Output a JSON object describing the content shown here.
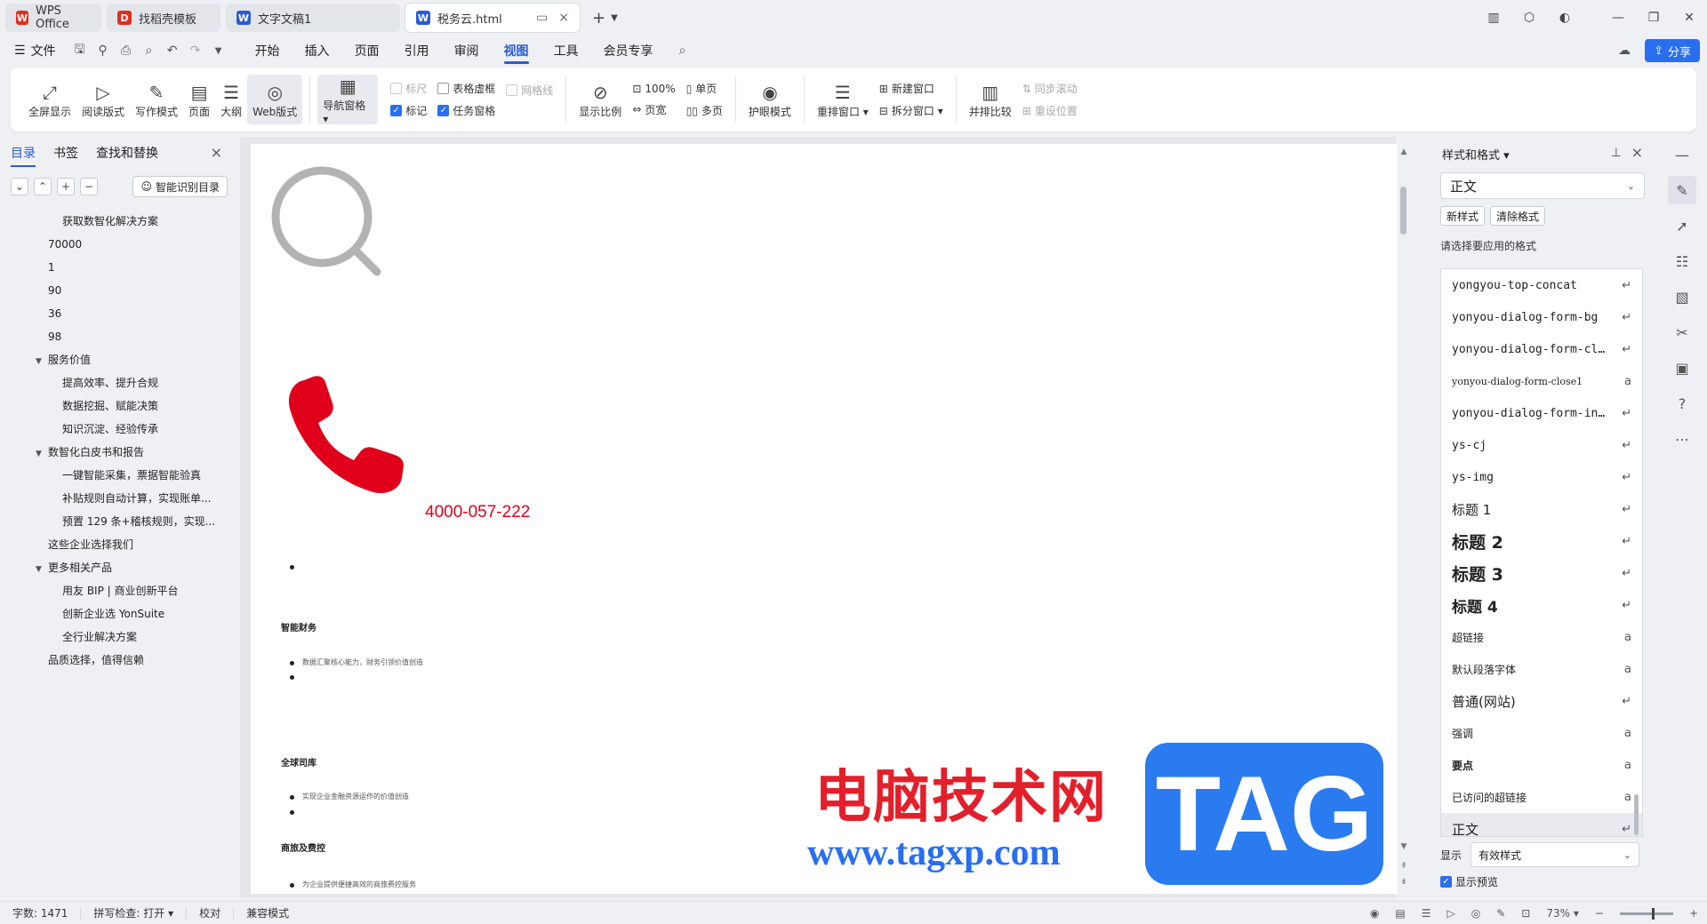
{
  "tabs": [
    {
      "label": "WPS Office",
      "icon": "wps-logo-icon",
      "color": "#e0301e",
      "glyph": "W"
    },
    {
      "label": "找稻壳模板",
      "icon": "docer-icon",
      "color": "#e0301e",
      "glyph": "D"
    },
    {
      "label": "文字文稿1",
      "icon": "writer-icon",
      "color": "#2a5bd7",
      "glyph": "W"
    },
    {
      "label": "税务云.html",
      "icon": "writer-icon",
      "color": "#2a5bd7",
      "glyph": "W"
    }
  ],
  "menu": {
    "file": "文件",
    "items": [
      "开始",
      "插入",
      "页面",
      "引用",
      "审阅",
      "视图",
      "工具",
      "会员专享"
    ],
    "active": "视图",
    "share": "分享"
  },
  "ribbon": {
    "fullscreen": "全屏显示",
    "reading": "阅读版式",
    "writing": "写作模式",
    "page": "页面",
    "outline": "大纲",
    "web": "Web版式",
    "navpane": "导航窗格",
    "ruler": "标尺",
    "table_grid": "表格虚框",
    "gridlines": "网格线",
    "marks": "标记",
    "taskpane": "任务窗格",
    "zoom": "显示比例",
    "hundred": "100%",
    "pagewidth": "页宽",
    "single": "单页",
    "multi": "多页",
    "eyecare": "护眼模式",
    "arrange": "重排窗口",
    "newwindow": "新建窗口",
    "split": "拆分窗口",
    "sidebyside": "并排比较",
    "syncscroll": "同步滚动",
    "resetpos": "重设位置"
  },
  "leftpane": {
    "tabs": [
      "目录",
      "书签",
      "查找和替换"
    ],
    "smart_toc": "智能识别目录",
    "toc": [
      {
        "text": "获取数智化解决方案",
        "level": 2,
        "caret": ""
      },
      {
        "text": "70000",
        "level": 1,
        "caret": ""
      },
      {
        "text": "1",
        "level": 1,
        "caret": ""
      },
      {
        "text": "90",
        "level": 1,
        "caret": ""
      },
      {
        "text": "36",
        "level": 1,
        "caret": ""
      },
      {
        "text": "98",
        "level": 1,
        "caret": ""
      },
      {
        "text": "服务价值",
        "level": 1,
        "caret": "▼"
      },
      {
        "text": "提高效率、提升合规",
        "level": 2,
        "caret": ""
      },
      {
        "text": "数据挖掘、赋能决策",
        "level": 2,
        "caret": ""
      },
      {
        "text": "知识沉淀、经验传承",
        "level": 2,
        "caret": ""
      },
      {
        "text": "数智化白皮书和报告",
        "level": 1,
        "caret": "▼"
      },
      {
        "text": "一键智能采集，票据智能验真",
        "level": 2,
        "caret": ""
      },
      {
        "text": "补贴规则自动计算，实现账单...",
        "level": 2,
        "caret": ""
      },
      {
        "text": "预置 129 条+稽核规则，实现...",
        "level": 2,
        "caret": ""
      },
      {
        "text": "这些企业选择我们",
        "level": 1,
        "caret": ""
      },
      {
        "text": "更多相关产品",
        "level": 1,
        "caret": "▼"
      },
      {
        "text": "用友 BIP | 商业创新平台",
        "level": 2,
        "caret": ""
      },
      {
        "text": "创新企业选 YonSuite",
        "level": 2,
        "caret": ""
      },
      {
        "text": "全行业解决方案",
        "level": 2,
        "caret": ""
      },
      {
        "text": "品质选择，值得信赖",
        "level": 1,
        "caret": ""
      }
    ]
  },
  "doc": {
    "phone_number": "4000-057-222",
    "h1": "智能财务",
    "s1": "数据汇聚核心能力，财务引领价值创造",
    "h2": "全球司库",
    "s2": "实现企业金融资源运作的价值创造",
    "h3": "商旅及费控",
    "s3": "为企业提供便捷高效的商旅费控服务"
  },
  "watermark": {
    "cn": "电脑技术网",
    "url": "www.tagxp.com",
    "tag": "TAG"
  },
  "rightpane": {
    "title": "样式和格式",
    "current_style": "正文",
    "new_style": "新样式",
    "clear_format": "清除格式",
    "choose_label": "请选择要应用的格式",
    "styles": [
      {
        "name": "yongyou-top-concat",
        "cls": "mono",
        "mark": "↵"
      },
      {
        "name": "yonyou-dialog-form-bg",
        "cls": "mono",
        "mark": "↵"
      },
      {
        "name": "yonyou-dialog-form-close",
        "cls": "mono",
        "mark": "↵"
      },
      {
        "name": "yonyou-dialog-form-close1",
        "cls": "tiny",
        "mark": "a"
      },
      {
        "name": "yonyou-dialog-form-input",
        "cls": "mono",
        "mark": "↵"
      },
      {
        "name": "ys-cj",
        "cls": "mono",
        "mark": "↵"
      },
      {
        "name": "ys-img",
        "cls": "mono",
        "mark": "↵"
      },
      {
        "name": "标题 1",
        "cls": "h1",
        "mark": "↵"
      },
      {
        "name": "标题 2",
        "cls": "h2",
        "mark": "↵"
      },
      {
        "name": "标题 3",
        "cls": "h3",
        "mark": "↵"
      },
      {
        "name": "标题 4",
        "cls": "h4",
        "mark": "↵"
      },
      {
        "name": "超链接",
        "cls": "sm",
        "mark": "a"
      },
      {
        "name": "默认段落字体",
        "cls": "sm",
        "mark": "a"
      },
      {
        "name": "普通(网站)",
        "cls": "md",
        "mark": "↵"
      },
      {
        "name": "强调",
        "cls": "sm",
        "mark": "a"
      },
      {
        "name": "要点",
        "cls": "bold",
        "mark": "a"
      },
      {
        "name": "已访问的超链接",
        "cls": "sm",
        "mark": "a"
      },
      {
        "name": "正文",
        "cls": "sel md",
        "mark": "↵"
      }
    ],
    "show_label": "显示",
    "show_value": "有效样式",
    "preview": "显示预览"
  },
  "status": {
    "wordcount": "字数: 1471",
    "spellcheck": "拼写检查: 打开",
    "proof": "校对",
    "compat": "兼容模式",
    "zoom": "73%"
  },
  "colors": {
    "accent": "#2a5bd7",
    "phone_red": "#e0001b",
    "share_blue": "#2a6ef0"
  }
}
